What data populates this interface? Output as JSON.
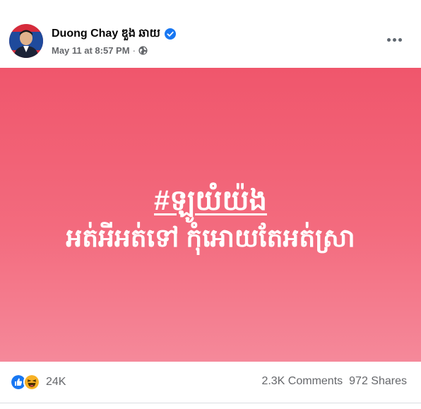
{
  "post": {
    "author": {
      "name": "Duong Chay ឌួង ឆាយ",
      "verified": true
    },
    "timestamp": "May 11 at 8:57 PM",
    "separator": "·",
    "privacy_icon": "globe-icon",
    "more_icon": "more-horizontal-icon"
  },
  "banner": {
    "background_colors": [
      "#f0566c",
      "#f5899a"
    ],
    "hashtag": "#ឡូយំយ៉ង",
    "slogan": "អត់អីអត់ទៅ កុំអោយតែអត់ស្រា"
  },
  "engagement": {
    "reactions": [
      "like-icon",
      "haha-icon"
    ],
    "reaction_count": "24K",
    "comments": "2.3K Comments",
    "shares": "972 Shares"
  },
  "colors": {
    "verified_blue": "#1877f2",
    "secondary_text": "#65676b"
  }
}
